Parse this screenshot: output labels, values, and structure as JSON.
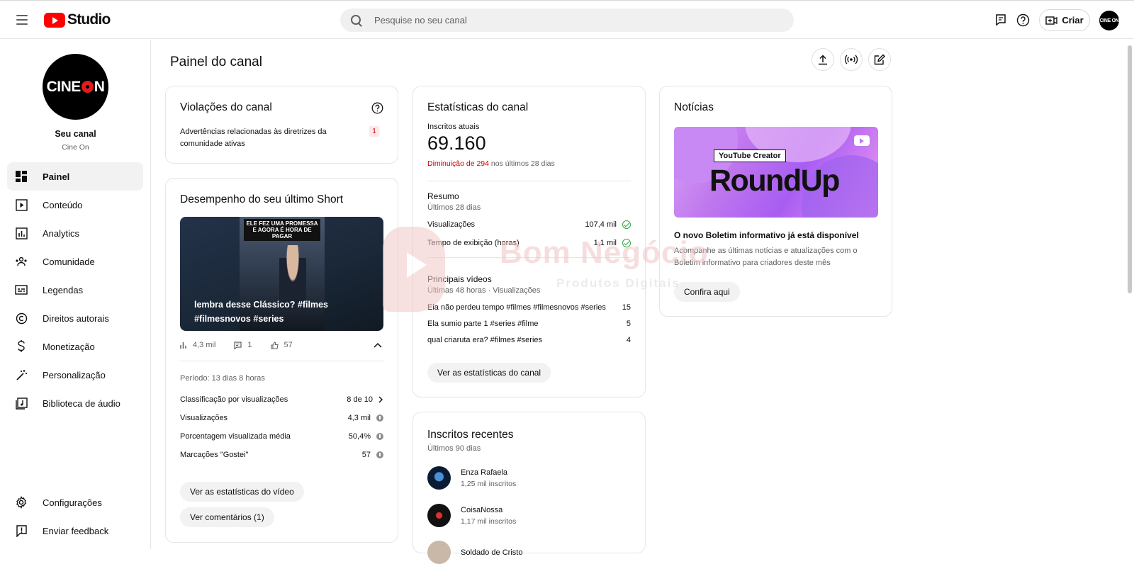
{
  "header": {
    "logo_text": "Studio",
    "search_placeholder": "Pesquise no seu canal",
    "create_label": "Criar",
    "avatar_text": "CINE ON"
  },
  "sidebar": {
    "channel_avatar_text_left": "CINE",
    "channel_avatar_text_right": "N",
    "channel_title": "Seu canal",
    "channel_name": "Cine On",
    "items": [
      {
        "label": "Painel",
        "icon": "dashboard-icon",
        "active": true
      },
      {
        "label": "Conteúdo",
        "icon": "content-icon"
      },
      {
        "label": "Analytics",
        "icon": "analytics-icon"
      },
      {
        "label": "Comunidade",
        "icon": "community-icon"
      },
      {
        "label": "Legendas",
        "icon": "subtitles-icon"
      },
      {
        "label": "Direitos autorais",
        "icon": "copyright-icon"
      },
      {
        "label": "Monetização",
        "icon": "monetization-icon"
      },
      {
        "label": "Personalização",
        "icon": "customization-icon"
      },
      {
        "label": "Biblioteca de áudio",
        "icon": "audio-library-icon"
      }
    ],
    "bottom_items": [
      {
        "label": "Configurações",
        "icon": "gear-icon"
      },
      {
        "label": "Enviar feedback",
        "icon": "feedback-icon"
      }
    ]
  },
  "main": {
    "page_title": "Painel do canal"
  },
  "violations": {
    "title": "Violações do canal",
    "text": "Advertências relacionadas às diretrizes da comunidade ativas",
    "count": "1"
  },
  "short": {
    "title": "Desempenho do seu último Short",
    "thumb_caption": "ELE FEZ UMA PROMESSA E AGORA É HORA DE PAGAR",
    "thumb_title": "lembra desse Clássico? #filmes #filmesnovos #series",
    "views_inline": "4,3 mil",
    "comments_inline": "1",
    "likes_inline": "57",
    "period": "Período: 13 dias 8 horas",
    "rows": [
      {
        "label": "Classificação por visualizações",
        "value": "8 de 10"
      },
      {
        "label": "Visualizações",
        "value": "4,3 mil"
      },
      {
        "label": "Porcentagem visualizada média",
        "value": "50,4%"
      },
      {
        "label": "Marcações \"Gostei\"",
        "value": "57"
      }
    ],
    "btn_stats": "Ver as estatísticas do vídeo",
    "btn_comments": "Ver comentários (1)"
  },
  "stats": {
    "title": "Estatísticas do canal",
    "subs_label": "Inscritos atuais",
    "subs_value": "69.160",
    "decrease": "Diminuição de 294",
    "decrease_suffix": " nos últimos 28 dias",
    "summary_title": "Resumo",
    "summary_period": "Últimos 28 dias",
    "summary_rows": [
      {
        "label": "Visualizações",
        "value": "107,4 mil"
      },
      {
        "label": "Tempo de exibição (horas)",
        "value": "1,1 mil"
      }
    ],
    "top_title": "Principais vídeos",
    "top_period": "Últimas 48 horas · Visualizações",
    "top_videos": [
      {
        "title": "Ela não perdeu tempo #filmes #filmesnovos #series",
        "views": "15"
      },
      {
        "title": "Ela sumio parte 1 #series #filme",
        "views": "5"
      },
      {
        "title": "qual criaruta era? #filmes #series",
        "views": "4"
      }
    ],
    "btn": "Ver as estatísticas do canal"
  },
  "recent": {
    "title": "Inscritos recentes",
    "period": "Últimos 90 dias",
    "subs": [
      {
        "name": "Enza Rafaela",
        "count": "1,25 mil inscritos"
      },
      {
        "name": "CoisaNossa",
        "count": "1,17 mil inscritos"
      },
      {
        "name": "Soldado de Cristo",
        "count": ""
      }
    ]
  },
  "news": {
    "title": "Notícias",
    "banner_tag": "YouTube Creator",
    "banner_title": "RoundUp",
    "headline": "O novo Boletim informativo já está disponível",
    "body": "Acompanhe as últimas notícias e atualizações com o Boletim informativo para criadores deste mês",
    "btn": "Confira aqui"
  },
  "watermark": {
    "title": "Bom Negócio",
    "subtitle": "Produtos Digitais"
  },
  "colors": {
    "brand_red": "#ff0000",
    "decrease_red": "#cc0000",
    "check_green": "#2ba640"
  }
}
